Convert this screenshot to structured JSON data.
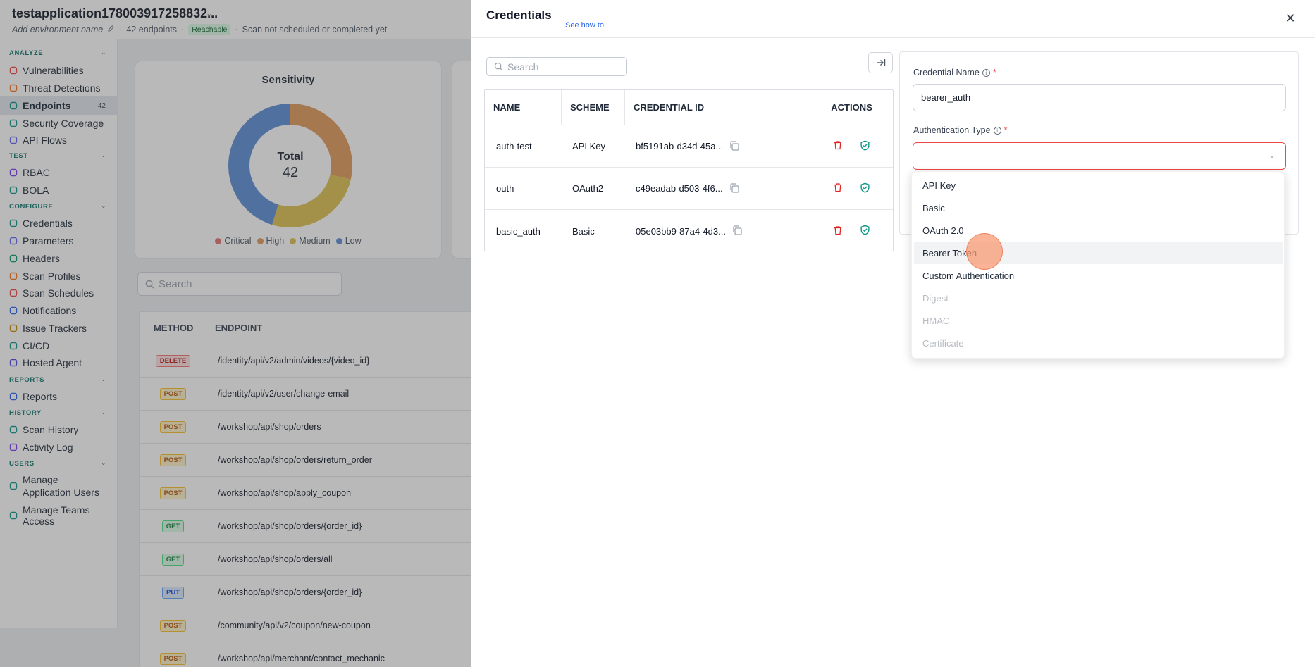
{
  "header": {
    "app_title": "testapplication178003917258832...",
    "env_placeholder": "Add environment name",
    "endpoints_count": "42 endpoints",
    "reachable": "Reachable",
    "scan_status": "Scan not scheduled or completed yet"
  },
  "sidebar": {
    "sections": [
      {
        "title": "ANALYZE",
        "items": [
          {
            "label": "Vulnerabilities",
            "icon": "bug-icon"
          },
          {
            "label": "Threat Detections",
            "icon": "alert-icon"
          },
          {
            "label": "Endpoints",
            "icon": "endpoints-icon",
            "count": "42",
            "active": true
          },
          {
            "label": "Security Coverage",
            "icon": "shield-icon"
          },
          {
            "label": "API Flows",
            "icon": "flow-icon"
          }
        ]
      },
      {
        "title": "TEST",
        "items": [
          {
            "label": "RBAC",
            "icon": "users-icon"
          },
          {
            "label": "BOLA",
            "icon": "shield-check-icon"
          }
        ]
      },
      {
        "title": "CONFIGURE",
        "items": [
          {
            "label": "Credentials",
            "icon": "key-icon"
          },
          {
            "label": "Parameters",
            "icon": "braces-icon"
          },
          {
            "label": "Headers",
            "icon": "headers-icon"
          },
          {
            "label": "Scan Profiles",
            "icon": "profile-icon"
          },
          {
            "label": "Scan Schedules",
            "icon": "calendar-icon"
          },
          {
            "label": "Notifications",
            "icon": "bell-icon"
          },
          {
            "label": "Issue Trackers",
            "icon": "tracker-icon"
          },
          {
            "label": "CI/CD",
            "icon": "cicd-icon"
          },
          {
            "label": "Hosted Agent",
            "icon": "agent-icon"
          }
        ]
      },
      {
        "title": "REPORTS",
        "items": [
          {
            "label": "Reports",
            "icon": "report-icon"
          }
        ]
      },
      {
        "title": "HISTORY",
        "items": [
          {
            "label": "Scan History",
            "icon": "history-icon"
          },
          {
            "label": "Activity Log",
            "icon": "log-icon"
          }
        ]
      },
      {
        "title": "USERS",
        "items": [
          {
            "label": "Manage Application Users",
            "icon": "user-icon"
          },
          {
            "label": "Manage Teams Access",
            "icon": "team-icon"
          }
        ]
      }
    ]
  },
  "sensitivity_card": {
    "title": "Sensitivity",
    "total_label": "Total",
    "total_value": "42"
  },
  "chart_data": {
    "type": "pie",
    "title": "Sensitivity",
    "center_label": "Total",
    "center_value": 42,
    "series": [
      {
        "name": "Critical",
        "value": 0,
        "color": "#e57373"
      },
      {
        "name": "High",
        "value": 12,
        "color": "#e0995a"
      },
      {
        "name": "Medium",
        "value": 11,
        "color": "#ddc151"
      },
      {
        "name": "Low",
        "value": 19,
        "color": "#5b8fd6"
      }
    ],
    "legend_position": "bottom"
  },
  "endpoint_search_placeholder": "Search",
  "endpoint_table": {
    "headers": [
      "METHOD",
      "ENDPOINT"
    ],
    "rows": [
      {
        "method": "DELETE",
        "path": "/identity/api/v2/admin/videos/{video_id}"
      },
      {
        "method": "POST",
        "path": "/identity/api/v2/user/change-email"
      },
      {
        "method": "POST",
        "path": "/workshop/api/shop/orders"
      },
      {
        "method": "POST",
        "path": "/workshop/api/shop/orders/return_order"
      },
      {
        "method": "POST",
        "path": "/workshop/api/shop/apply_coupon"
      },
      {
        "method": "GET",
        "path": "/workshop/api/shop/orders/{order_id}"
      },
      {
        "method": "GET",
        "path": "/workshop/api/shop/orders/all"
      },
      {
        "method": "PUT",
        "path": "/workshop/api/shop/orders/{order_id}"
      },
      {
        "method": "POST",
        "path": "/community/api/v2/coupon/new-coupon"
      },
      {
        "method": "POST",
        "path": "/workshop/api/merchant/contact_mechanic"
      }
    ]
  },
  "drawer": {
    "title": "Credentials",
    "see_how": "See how to",
    "search_placeholder": "Search",
    "table": {
      "headers": {
        "name": "NAME",
        "scheme": "SCHEME",
        "id": "CREDENTIAL ID",
        "actions": "ACTIONS"
      },
      "rows": [
        {
          "name": "auth-test",
          "scheme": "API Key",
          "id": "bf5191ab-d34d-45a..."
        },
        {
          "name": "outh",
          "scheme": "OAuth2",
          "id": "c49eadab-d503-4f6..."
        },
        {
          "name": "basic_auth",
          "scheme": "Basic",
          "id": "05e03bb9-87a4-4d3..."
        }
      ]
    },
    "form": {
      "name_label": "Credential Name",
      "name_value": "bearer_auth",
      "auth_label": "Authentication Type",
      "required_mark": "*",
      "auth_options": [
        {
          "label": "API Key",
          "disabled": false
        },
        {
          "label": "Basic",
          "disabled": false
        },
        {
          "label": "OAuth 2.0",
          "disabled": false
        },
        {
          "label": "Bearer Token",
          "disabled": false,
          "hover": true
        },
        {
          "label": "Custom Authentication",
          "disabled": false
        },
        {
          "label": "Digest",
          "disabled": true
        },
        {
          "label": "HMAC",
          "disabled": true
        },
        {
          "label": "Certificate",
          "disabled": true
        }
      ]
    }
  },
  "colors": {
    "accent_teal": "#0f766e",
    "required_red": "#ef4444",
    "link_blue": "#2563eb",
    "delete_red": "#dc2626",
    "shield_teal": "#0d9488"
  }
}
